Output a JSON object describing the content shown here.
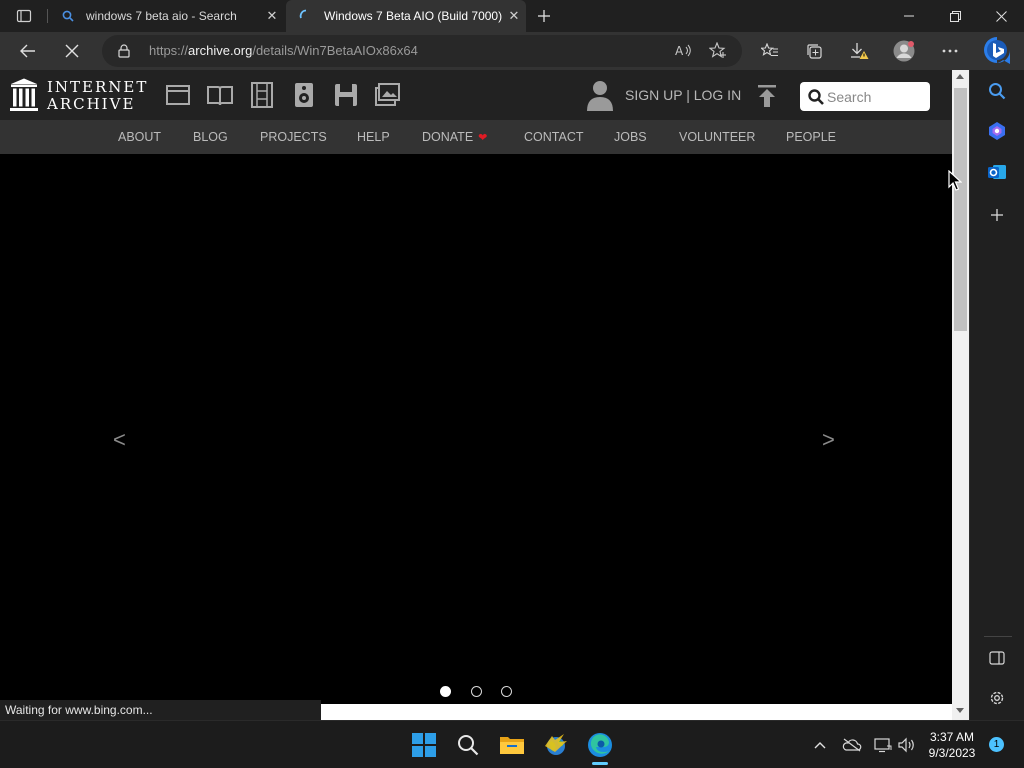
{
  "browser": {
    "tabs": [
      {
        "title": "windows 7 beta aio - Search",
        "active": false
      },
      {
        "title": "Windows 7 Beta AIO (Build 7000)",
        "active": true
      }
    ],
    "address": {
      "prefix": "https://",
      "host": "archive.org",
      "path": "/details/Win7BetaAIOx86x64"
    }
  },
  "site": {
    "logo_line1": "INTERNET",
    "logo_line2": "ARCHIVE",
    "media_icons": [
      "web-icon",
      "texts-icon",
      "video-icon",
      "audio-icon",
      "software-icon",
      "images-icon"
    ],
    "signin": "SIGN UP | LOG IN",
    "search_placeholder": "Search",
    "nav": [
      "ABOUT",
      "BLOG",
      "PROJECTS",
      "HELP",
      "DONATE",
      "CONTACT",
      "JOBS",
      "VOLUNTEER",
      "PEOPLE"
    ],
    "donate_heart": "❤",
    "carousel": {
      "prev": "<",
      "next": ">",
      "slides": 3,
      "active_slide": 1
    }
  },
  "status_text": "Waiting for www.bing.com...",
  "taskbar": {
    "time": "3:37 AM",
    "date": "9/3/2023",
    "notifications": "1"
  },
  "colors": {
    "accent": "#60cdff",
    "heart": "#e01b24",
    "bing": "#2b7de9"
  }
}
